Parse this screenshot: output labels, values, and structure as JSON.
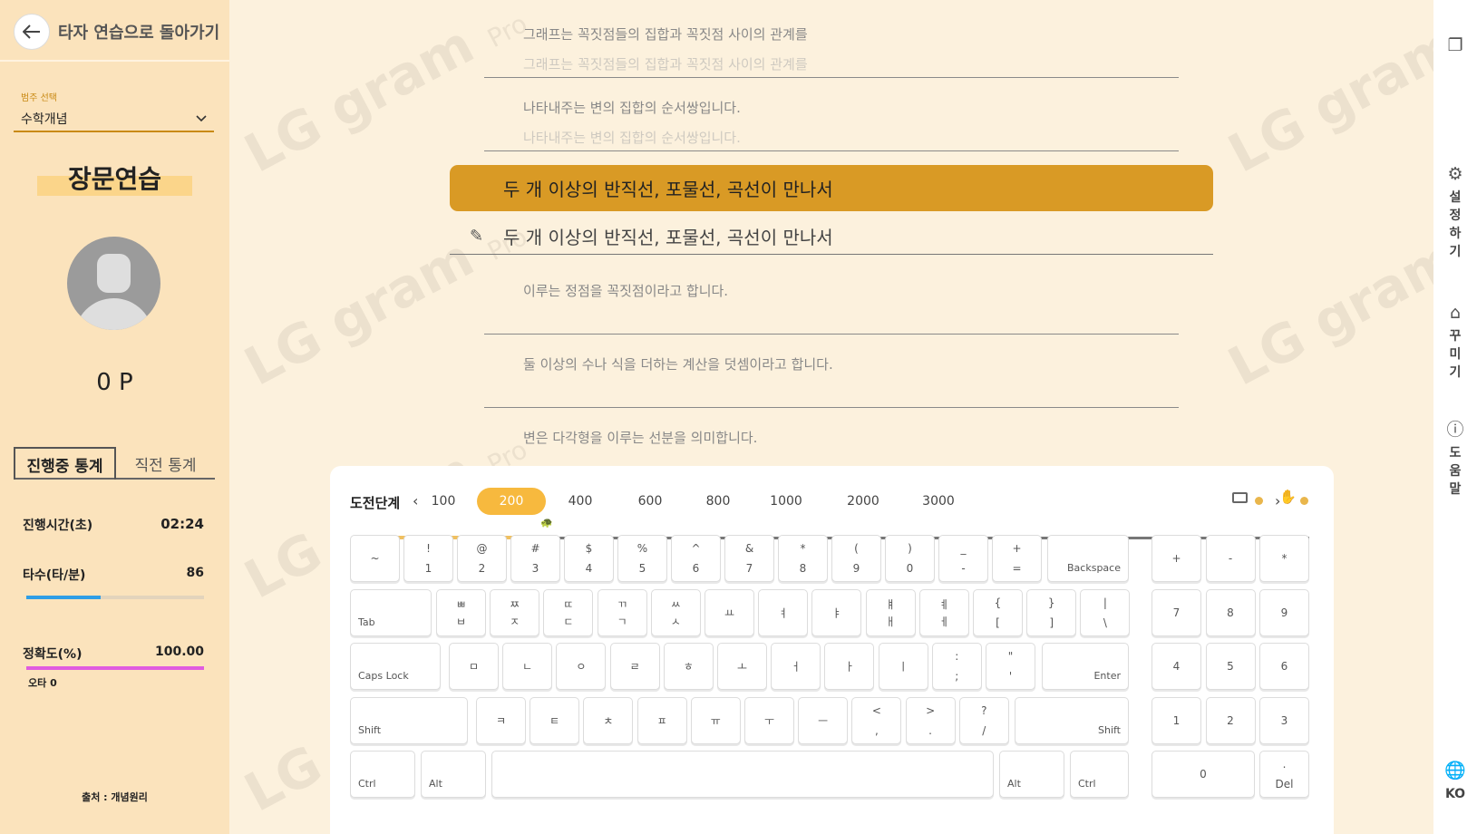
{
  "header": {
    "back_label": "타자 연습으로 돌아가기"
  },
  "category": {
    "label": "범주 선택",
    "value": "수학개념"
  },
  "mode_title": "장문연습",
  "points": "0 P",
  "tabs": [
    "진행중 통계",
    "직전 통계"
  ],
  "stats": {
    "time_label": "진행시간(초)",
    "time_value": "02:24",
    "speed_label": "타수(타/분)",
    "speed_value": "86",
    "speed_fill": 0.42,
    "accuracy_label": "정확도(%)",
    "accuracy_value": "100.00",
    "accuracy_fill": 1.0,
    "typo_label": "오타 0"
  },
  "source_label": "출처 : 개념원리",
  "text_lines": {
    "prev1": "그래프는 꼭짓점들의 집합과 꼭짓점 사이의 관계를",
    "prev1_typed": "그래프는 꼭짓점들의 집합과 꼭짓점 사이의 관계를",
    "prev2": "나타내주는 변의 집합의 순서쌍입니다.",
    "prev2_typed": "나타내주는 변의 집합의 순서쌍입니다.",
    "active": "두 개 이상의 반직선, 포물선, 곡선이 만나서",
    "input": "두 개 이상의 반직선, 포물선, 곡선이 만나서",
    "next1": "이루는 정점을 꼭짓점이라고 합니다.",
    "next2": "둘 이상의 수나 식을 더하는 계산을 덧셈이라고 합니다.",
    "next3": "변은 다각형을 이루는 선분을 의미합니다."
  },
  "watermark": {
    "text": "LG gram",
    "suffix": "Pro"
  },
  "challenge": {
    "title": "도전단계",
    "prev": "‹",
    "next": "›",
    "levels": [
      "100",
      "200",
      "400",
      "600",
      "800",
      "1000",
      "2000",
      "3000"
    ],
    "selected": "200",
    "progress": 0.21
  },
  "keyboard": {
    "row1": [
      [
        "~",
        ""
      ],
      [
        "!",
        "1"
      ],
      [
        "@",
        "2"
      ],
      [
        "#",
        "3"
      ],
      [
        "$",
        "4"
      ],
      [
        "%",
        "5"
      ],
      [
        "^",
        "6"
      ],
      [
        "&",
        "7"
      ],
      [
        "*",
        "8"
      ],
      [
        "(",
        "9"
      ],
      [
        ")",
        "0"
      ],
      [
        "_",
        "-"
      ],
      [
        "+",
        "="
      ]
    ],
    "backspace": "Backspace",
    "tab": "Tab",
    "row2": [
      [
        "ㅃ",
        "ㅂ"
      ],
      [
        "ㅉ",
        "ㅈ"
      ],
      [
        "ㄸ",
        "ㄷ"
      ],
      [
        "ㄲ",
        "ㄱ"
      ],
      [
        "ㅆ",
        "ㅅ"
      ],
      [
        "",
        "ㅛ"
      ],
      [
        "",
        "ㅕ"
      ],
      [
        "",
        "ㅑ"
      ],
      [
        "ㅒ",
        "ㅐ"
      ],
      [
        "ㅖ",
        "ㅔ"
      ],
      [
        "{",
        "["
      ],
      [
        "}",
        "]"
      ],
      [
        "|",
        "\\"
      ]
    ],
    "caps": "Caps Lock",
    "row3": [
      [
        "",
        "ㅁ"
      ],
      [
        "",
        "ㄴ"
      ],
      [
        "",
        "ㅇ"
      ],
      [
        "",
        "ㄹ"
      ],
      [
        "",
        "ㅎ"
      ],
      [
        "",
        "ㅗ"
      ],
      [
        "",
        "ㅓ"
      ],
      [
        "",
        "ㅏ"
      ],
      [
        "",
        "ㅣ"
      ],
      [
        ":",
        ";"
      ],
      [
        "\"",
        "'"
      ]
    ],
    "enter": "Enter",
    "shift": "Shift",
    "row4": [
      [
        "",
        "ㅋ"
      ],
      [
        "",
        "ㅌ"
      ],
      [
        "",
        "ㅊ"
      ],
      [
        "",
        "ㅍ"
      ],
      [
        "",
        "ㅠ"
      ],
      [
        "",
        "ㅜ"
      ],
      [
        "",
        "ㅡ"
      ],
      [
        "<",
        ","
      ],
      [
        ">",
        "."
      ],
      [
        "?",
        "/"
      ]
    ],
    "ctrl": "Ctrl",
    "alt": "Alt",
    "numpad": [
      [
        "+",
        "-",
        "*"
      ],
      [
        "7",
        "8",
        "9"
      ],
      [
        "4",
        "5",
        "6"
      ],
      [
        "1",
        "2",
        "3"
      ]
    ],
    "num0": "0",
    "del_top": ".",
    "del": "Del"
  },
  "rightbar": {
    "settings": "설정하기",
    "decorate": "꾸미기",
    "help": "도움말",
    "lang": "KO"
  },
  "colors": {
    "accent": "#d99a25",
    "sidebar": "#fbe3bc",
    "speed_bar": "#2f9ee6",
    "accuracy_bar": "#e05ce0"
  }
}
